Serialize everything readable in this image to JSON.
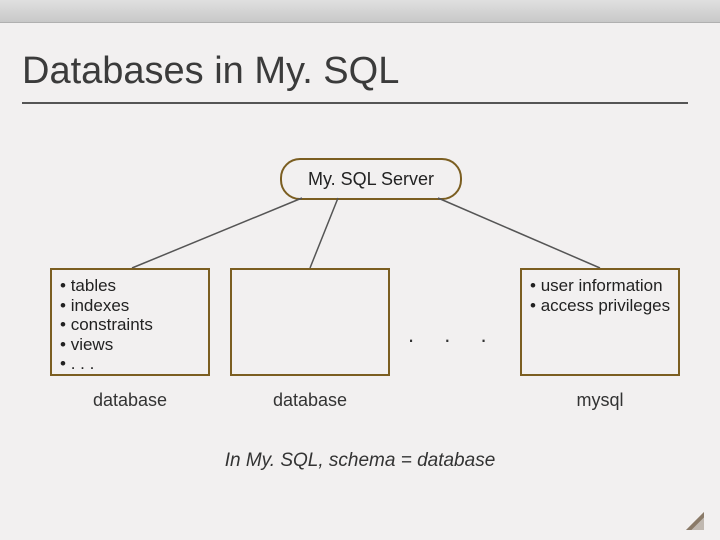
{
  "title": "Databases in My. SQL",
  "server_label": "My. SQL Server",
  "box1": {
    "items": [
      "tables",
      "indexes",
      "constraints",
      "views",
      ". . ."
    ],
    "label": "database"
  },
  "box2": {
    "label": "database"
  },
  "ellipsis": ". . .",
  "box3": {
    "items": [
      "user information",
      "access privileges"
    ],
    "label": "mysql"
  },
  "caption": "In My. SQL, schema = database"
}
